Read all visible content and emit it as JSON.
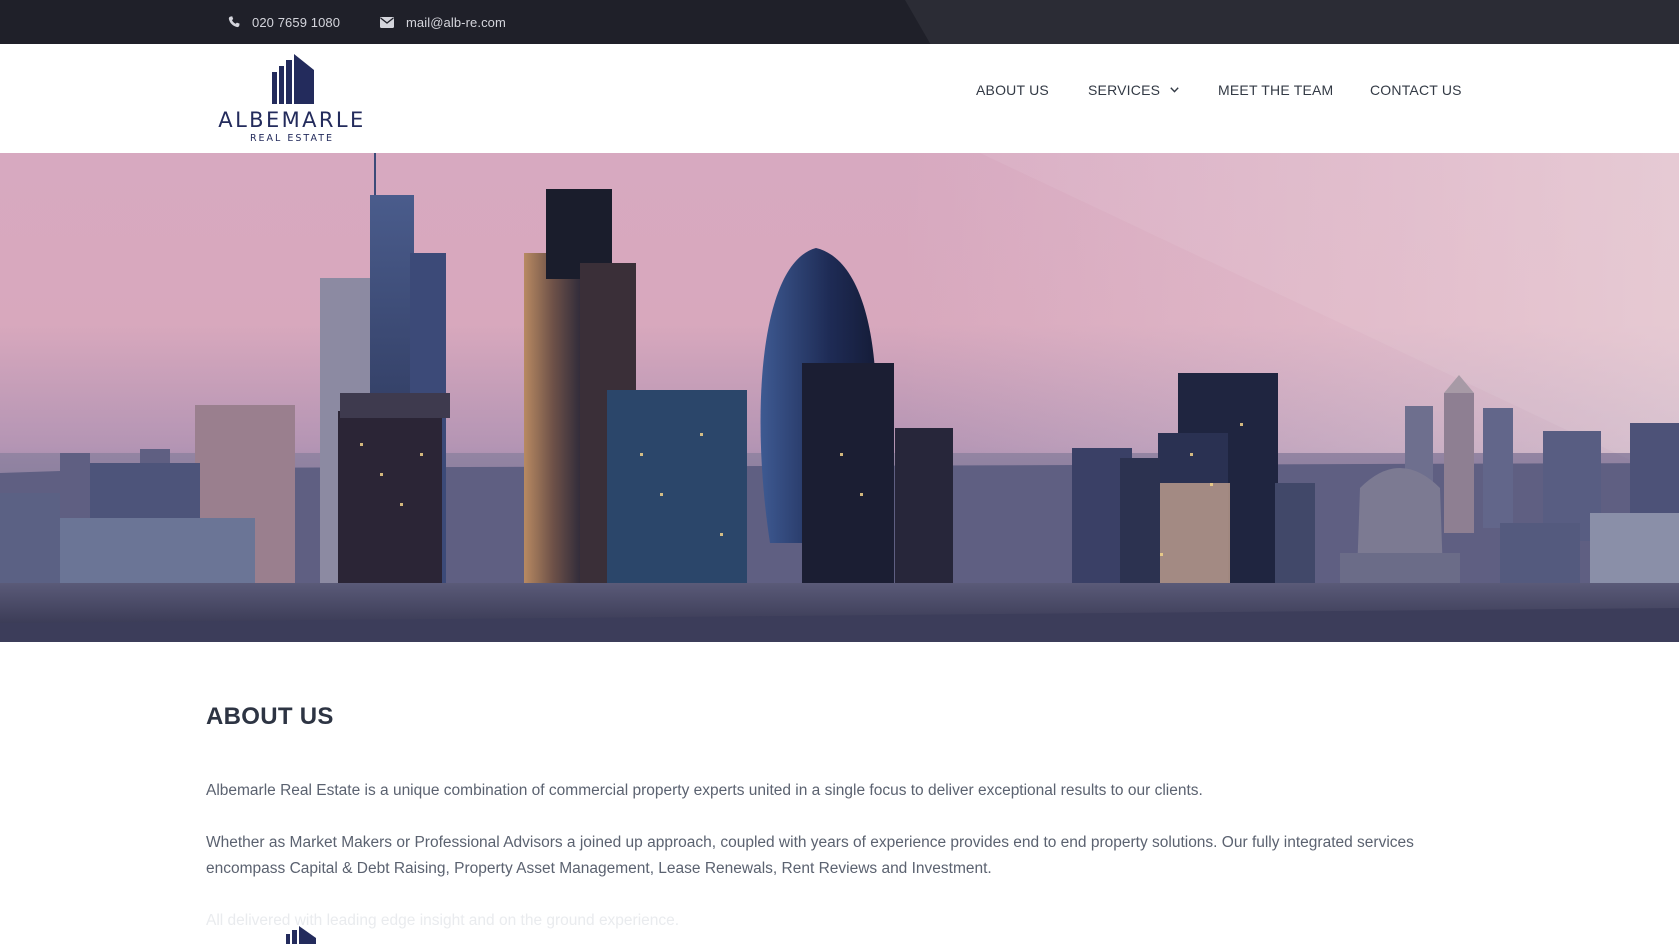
{
  "topbar": {
    "phone_icon": "phone-icon",
    "phone": "020 7659 1080",
    "mail_icon": "envelope-icon",
    "email": "mail@alb-re.com"
  },
  "logo": {
    "wordmark": "ALBEMARLE",
    "subtitle": "REAL ESTATE",
    "icon": "building-logo-icon"
  },
  "nav": {
    "items": [
      {
        "label": "ABOUT US"
      },
      {
        "label": "SERVICES",
        "icon": "chevron-down-icon"
      },
      {
        "label": "MEET THE TEAM"
      },
      {
        "label": "CONTACT US"
      }
    ]
  },
  "hero": {
    "image": "london-city-skyline-at-dusk"
  },
  "about": {
    "title": "ABOUT US",
    "paragraphs": [
      "Albemarle Real Estate is a unique combination of commercial property experts united in a single focus to deliver exceptional results to our clients.",
      "Whether as Market Makers or Professional Advisors a joined up approach, coupled with years of experience provides end to end property solutions. Our fully integrated services encompass Capital & Debt Raising, Property Asset Management, Lease Renewals, Rent Reviews and Investment.",
      "All delivered with leading edge insight and on the ground experience."
    ]
  },
  "colors": {
    "topbar_bg": "#1f2029",
    "brand_navy": "#232b5c",
    "heading": "#2d3443",
    "body_text": "#5b6270"
  }
}
